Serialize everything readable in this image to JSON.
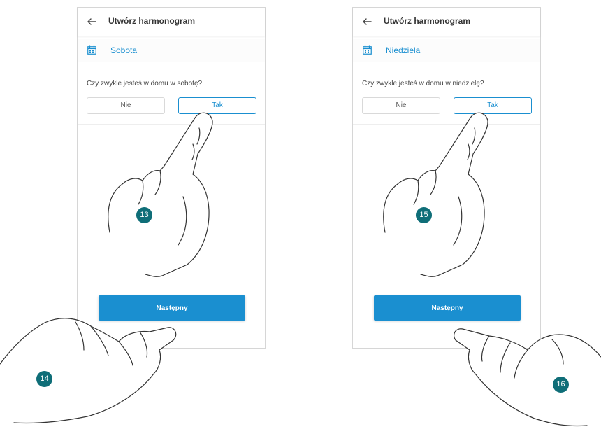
{
  "colors": {
    "accent": "#1a8fd0",
    "badge": "#0f6e78"
  },
  "screens": [
    {
      "title": "Utwórz harmonogram",
      "day": "Sobota",
      "question": "Czy zwykle jesteś w domu w sobotę?",
      "options": {
        "no": "Nie",
        "yes": "Tak",
        "selected": "yes"
      },
      "next_label": "Następny",
      "icons": [
        "back-arrow-icon",
        "calendar-icon"
      ]
    },
    {
      "title": "Utwórz harmonogram",
      "day": "Niedziela",
      "question": "Czy zwykle jesteś w domu w niedzielę?",
      "options": {
        "no": "Nie",
        "yes": "Tak",
        "selected": "yes"
      },
      "next_label": "Następny",
      "icons": [
        "back-arrow-icon",
        "calendar-icon"
      ]
    }
  ],
  "step_badges": [
    "13",
    "14",
    "15",
    "16"
  ]
}
